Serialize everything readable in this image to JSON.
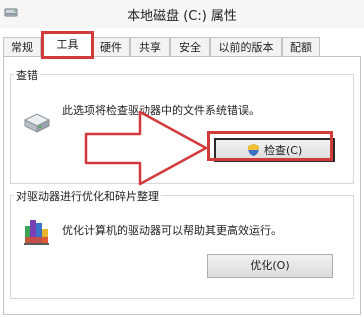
{
  "window": {
    "title": "本地磁盘 (C:) 属性"
  },
  "tabs": [
    {
      "label": "常规"
    },
    {
      "label": "工具"
    },
    {
      "label": "硬件"
    },
    {
      "label": "共享"
    },
    {
      "label": "安全"
    },
    {
      "label": "以前的版本"
    },
    {
      "label": "配额"
    }
  ],
  "active_tab": "工具",
  "error_check": {
    "group_title": "查错",
    "description": "此选项将检查驱动器中的文件系统错误。",
    "button_label": "检查(C)"
  },
  "optimize": {
    "group_title": "对驱动器进行优化和碎片整理",
    "description": "优化计算机的驱动器可以帮助其更高效运行。",
    "button_label": "优化(O)"
  },
  "colors": {
    "highlight": "#d23b3b",
    "panel_border": "#c4c4c4",
    "window_bg": "#ffffff"
  },
  "icons": {
    "title": "drive-icon",
    "error_check": "hard-drive-icon",
    "optimize": "defrag-icon",
    "check_button": "shield-icon"
  }
}
